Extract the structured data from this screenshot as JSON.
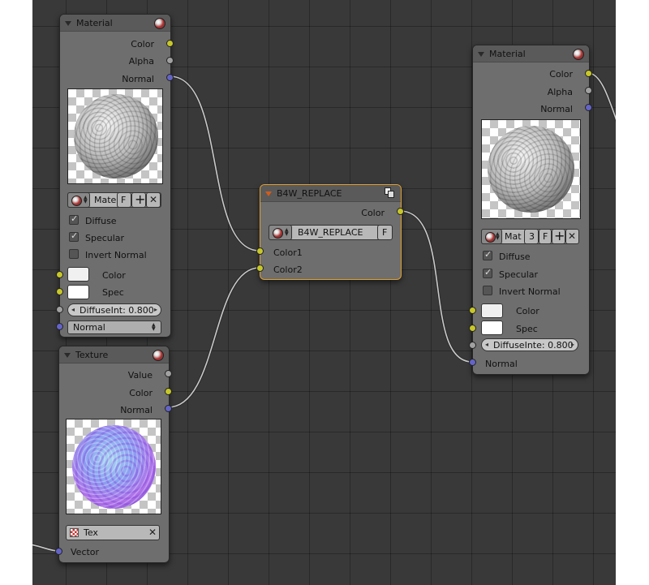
{
  "nodes": {
    "material_left": {
      "title": "Material",
      "outputs": [
        "Color",
        "Alpha",
        "Normal"
      ],
      "material_name": "Mate",
      "fake_user": "F",
      "checkboxes": [
        {
          "label": "Diffuse",
          "checked": true
        },
        {
          "label": "Specular",
          "checked": true
        },
        {
          "label": "Invert Normal",
          "checked": false
        }
      ],
      "color_inputs": [
        "Color",
        "Spec"
      ],
      "diffuse_intensity": "DiffuseInt: 0.800",
      "normal_dropdown": "Normal"
    },
    "texture": {
      "title": "Texture",
      "outputs": [
        "Value",
        "Color",
        "Normal"
      ],
      "texture_name": "Tex",
      "input": "Vector"
    },
    "b4w_replace": {
      "title": "B4W_REPLACE",
      "output": "Color",
      "group_name": "B4W_REPLACE",
      "fake_user": "F",
      "inputs": [
        "Color1",
        "Color2"
      ]
    },
    "material_right": {
      "title": "Material",
      "outputs": [
        "Color",
        "Alpha",
        "Normal"
      ],
      "material_name": "Mat",
      "users": "3",
      "fake_user": "F",
      "checkboxes": [
        {
          "label": "Diffuse",
          "checked": true
        },
        {
          "label": "Specular",
          "checked": true
        },
        {
          "label": "Invert Normal",
          "checked": false
        }
      ],
      "color_inputs": [
        "Color",
        "Spec"
      ],
      "diffuse_intensity": "DiffuseInte: 0.800",
      "input_normal": "Normal"
    }
  },
  "icons": {
    "check": "✓",
    "close": "✕",
    "plus": "+",
    "up": "▲",
    "down": "▼",
    "left": "◂",
    "right": "▸"
  },
  "colors": {
    "socket_color": "#c7c729",
    "socket_value": "#a1a1a1",
    "socket_vector": "#6464c7",
    "selected_outline": "#e0a030",
    "background": "#393939"
  }
}
